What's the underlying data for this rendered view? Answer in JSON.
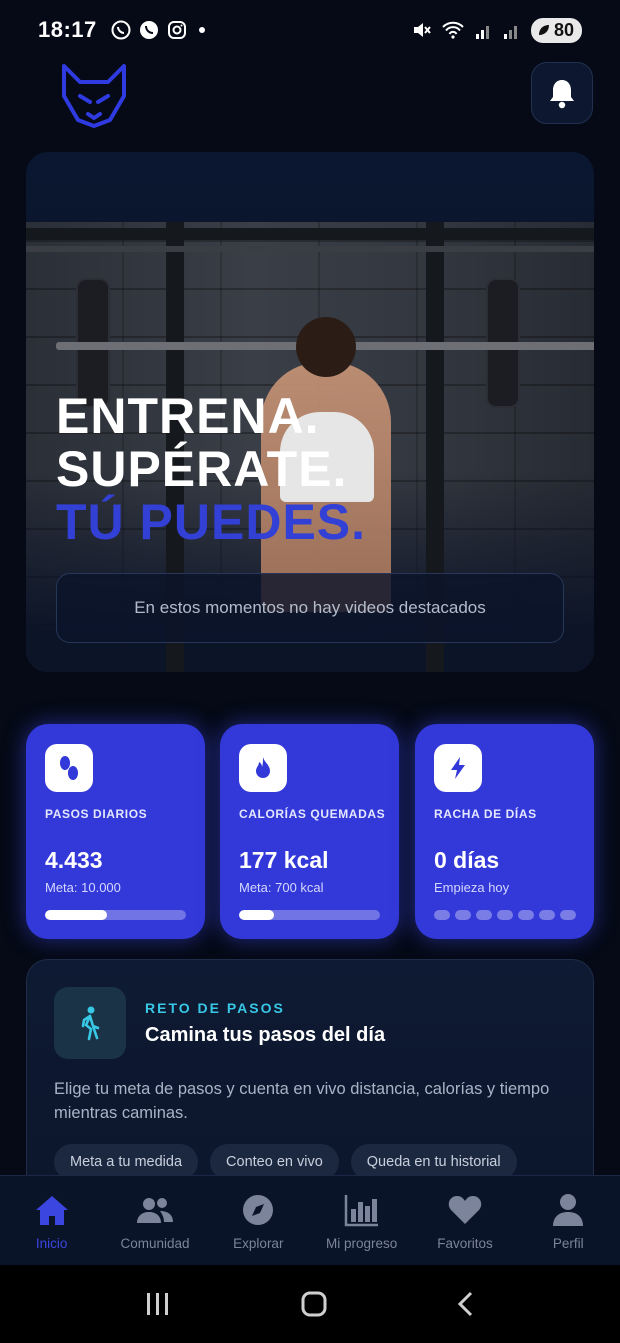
{
  "status_bar": {
    "time": "18:17",
    "battery": "80"
  },
  "hero": {
    "headline_line1": "ENTRENA.",
    "headline_line2": "SUPÉRATE.",
    "headline_line3": "TÚ PUEDES.",
    "empty_videos_text": "En estos momentos no hay videos destacados"
  },
  "stats": [
    {
      "label": "PASOS DIARIOS",
      "value": "4.433",
      "sub": "Meta: 10.000",
      "progress": 0.44,
      "icon": "footprints-icon"
    },
    {
      "label": "CALORÍAS QUEMADAS",
      "value": "177 kcal",
      "sub": "Meta: 700 kcal",
      "progress": 0.25,
      "icon": "flame-icon"
    },
    {
      "label": "RACHA DE DÍAS",
      "value": "0 días",
      "sub": "Empieza hoy",
      "streak_days": 7,
      "streak_done": 0,
      "icon": "bolt-icon"
    }
  ],
  "challenge": {
    "kicker": "RETO DE PASOS",
    "title": "Camina tus pasos del día",
    "description": "Elige tu meta de pasos y cuenta en vivo distancia, calorías y tiempo mientras caminas.",
    "chips": [
      "Meta a tu medida",
      "Conteo en vivo",
      "Queda en tu historial"
    ]
  },
  "nav": {
    "items": [
      {
        "label": "Inicio",
        "icon": "home-icon",
        "active": true
      },
      {
        "label": "Comunidad",
        "icon": "users-icon",
        "active": false
      },
      {
        "label": "Explorar",
        "icon": "compass-icon",
        "active": false
      },
      {
        "label": "Mi progreso",
        "icon": "chart-icon",
        "active": false
      },
      {
        "label": "Favoritos",
        "icon": "heart-icon",
        "active": false
      },
      {
        "label": "Perfil",
        "icon": "user-icon",
        "active": false
      }
    ]
  },
  "colors": {
    "accent": "#3338d8",
    "accent_text": "#3340d6",
    "cyan": "#38c8e6",
    "background": "#050a16"
  }
}
